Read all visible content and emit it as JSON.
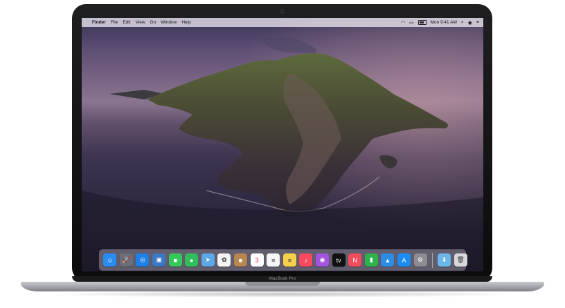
{
  "device": {
    "model_label": "MacBook Pro"
  },
  "menubar": {
    "apple_glyph": "",
    "app_name": "Finder",
    "items": [
      "File",
      "Edit",
      "View",
      "Go",
      "Window",
      "Help"
    ],
    "clock": "Mon 9:41 AM",
    "status_icons": [
      "wifi-icon",
      "airplay-icon",
      "battery-icon",
      "search-icon",
      "siri-icon",
      "control-center-icon"
    ]
  },
  "dock": {
    "apps": [
      {
        "name": "finder-icon",
        "glyph": "☺",
        "color": "#2a8cf0"
      },
      {
        "name": "launchpad-icon",
        "glyph": "🚀",
        "color": "#6a6f7a"
      },
      {
        "name": "safari-icon",
        "glyph": "◎",
        "color": "#1e7fe5"
      },
      {
        "name": "photos-preview-icon",
        "glyph": "▣",
        "color": "#3a78c4"
      },
      {
        "name": "facetime-icon",
        "glyph": "■",
        "color": "#34c759"
      },
      {
        "name": "messages-icon",
        "glyph": "●",
        "color": "#2fbe5a"
      },
      {
        "name": "maps-icon",
        "glyph": "➤",
        "color": "#5aa9e6"
      },
      {
        "name": "photos-icon",
        "glyph": "✿",
        "color": "#f4f4f4"
      },
      {
        "name": "contacts-icon",
        "glyph": "☻",
        "color": "#b88650"
      },
      {
        "name": "calendar-icon",
        "glyph": "3",
        "color": "#ffffff"
      },
      {
        "name": "reminders-icon",
        "glyph": "≡",
        "color": "#f6f6f6"
      },
      {
        "name": "notes-icon",
        "glyph": "≡",
        "color": "#f7d04b"
      },
      {
        "name": "music-icon",
        "glyph": "♪",
        "color": "#fb4a5e"
      },
      {
        "name": "podcasts-icon",
        "glyph": "◉",
        "color": "#a452e0"
      },
      {
        "name": "tv-icon",
        "glyph": "tv",
        "color": "#111111"
      },
      {
        "name": "news-icon",
        "glyph": "N",
        "color": "#f14c5c"
      },
      {
        "name": "numbers-icon",
        "glyph": "▮",
        "color": "#2cb34a"
      },
      {
        "name": "keynote-icon",
        "glyph": "▲",
        "color": "#2b8de8"
      },
      {
        "name": "app-store-icon",
        "glyph": "A",
        "color": "#1a8cf5"
      },
      {
        "name": "system-preferences-icon",
        "glyph": "⚙",
        "color": "#8c8c92"
      }
    ],
    "trailing": [
      {
        "name": "downloads-folder-icon",
        "glyph": "⬇",
        "color": "#6cb7ea"
      },
      {
        "name": "trash-icon",
        "glyph": "🗑",
        "color": "#d8d8dc"
      }
    ]
  }
}
